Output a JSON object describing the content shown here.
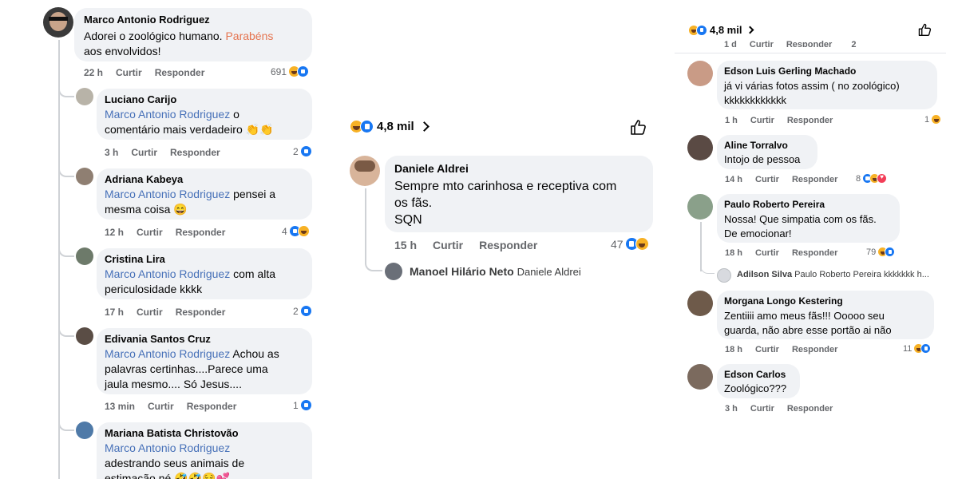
{
  "actions": {
    "like": "Curtir",
    "reply": "Responder"
  },
  "left": {
    "comments": [
      {
        "name": "Marco Antonio Rodriguez",
        "text": "Adorei o zoológico humano.",
        "highlight": "Parabéns",
        "text2": "aos envolvidos!",
        "time": "22 h",
        "count": "691"
      },
      {
        "name": "Luciano Carijo",
        "mention": "Marco Antonio Rodriguez",
        "text": "o",
        "text2": "comentário mais verdadeiro 👏👏",
        "time": "3 h",
        "count": "2"
      },
      {
        "name": "Adriana Kabeya",
        "mention": "Marco Antonio Rodriguez",
        "text": "pensei a",
        "text2": "mesma coisa 😄",
        "time": "12 h",
        "count": "4"
      },
      {
        "name": "Cristina Lira",
        "mention": "Marco Antonio Rodriguez",
        "text": "com alta",
        "text2": "periculosidade kkkk",
        "time": "17 h",
        "count": "2"
      },
      {
        "name": "Edivania Santos Cruz",
        "mention": "Marco Antonio Rodriguez",
        "text": "Achou as",
        "text2": "palavras certinhas....Parece uma",
        "text3": "jaula mesmo.... Só Jesus....",
        "time": "13 min",
        "count": "1"
      },
      {
        "name": "Mariana Batista Christovão",
        "mention": "Marco Antonio Rodriguez",
        "text2": "adestrando seus animais de",
        "text3": "estimação né 🤣🤣😌💕"
      }
    ]
  },
  "middle": {
    "reaction_total": "4,8 mil",
    "comment": {
      "name": "Daniele Aldrei",
      "line1": "Sempre mto carinhosa e receptiva com",
      "line2": "os fãs.",
      "line3": "SQN",
      "time": "15 h",
      "count": "47"
    },
    "reply": {
      "name": "Manoel Hilário Neto",
      "mention": "Daniele Aldrei"
    }
  },
  "right": {
    "reaction_total": "4,8 mil",
    "top_cut": {
      "time": "1 d",
      "count": "2"
    },
    "comments": [
      {
        "name": "Edson Luis Gerling Machado",
        "line1": "já vi várias fotos assim ( no zoológico)",
        "line2": "kkkkkkkkkkkk",
        "time": "1 h",
        "count": "1"
      },
      {
        "name": "Aline Torralvo",
        "line1": "Intojo de pessoa",
        "time": "14 h",
        "count": "8"
      },
      {
        "name": "Paulo Roberto Pereira",
        "line1": "Nossa! Que simpatia com os fãs.",
        "line2": "De emocionar!",
        "time": "18 h",
        "count": "79"
      },
      {
        "name": "Morgana Longo Kestering",
        "line1": "Zentiiii amo meus fãs!!! Ooooo seu",
        "line2": "guarda, não abre esse portão ai não",
        "time": "18 h",
        "count": "11"
      },
      {
        "name": "Edson Carlos",
        "line1": "Zoológico???",
        "time": "3 h"
      }
    ],
    "nested_reply": {
      "name": "Adilson Silva",
      "mention": "Paulo Roberto Pereira",
      "text": "kkkkkkk h..."
    }
  }
}
